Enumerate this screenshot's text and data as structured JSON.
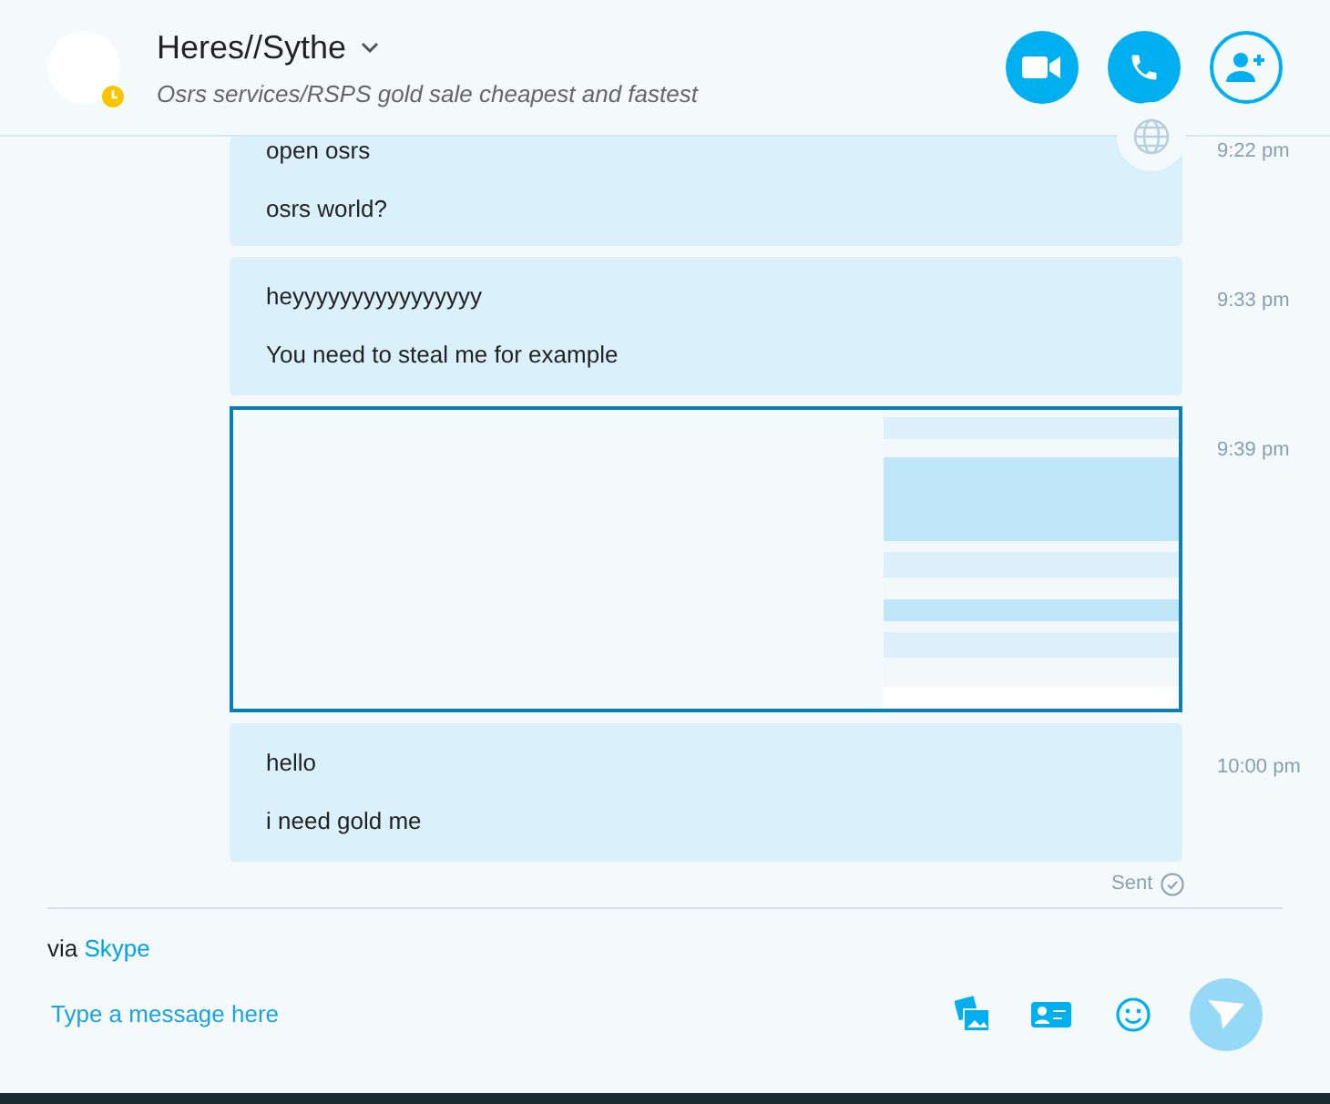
{
  "header": {
    "name": "Heres//Sythe",
    "mood": "Osrs services/RSPS gold sale cheapest and fastest",
    "away": true
  },
  "messages": [
    {
      "kind": "text",
      "lines": [
        "open osrs",
        "osrs world?"
      ],
      "time": "9:22 pm"
    },
    {
      "kind": "text",
      "lines": [
        "heyyyyyyyyyyyyyyyy",
        "You need to steal me for example"
      ],
      "time": "9:33 pm"
    },
    {
      "kind": "picture",
      "selected": true,
      "time": "9:39 pm"
    },
    {
      "kind": "text",
      "lines": [
        "hello",
        "i need gold me"
      ],
      "time": "10:00 pm"
    }
  ],
  "sent_status": "Sent",
  "via": {
    "prefix": "via",
    "service": "Skype"
  },
  "composer": {
    "placeholder": "Type a message here"
  }
}
